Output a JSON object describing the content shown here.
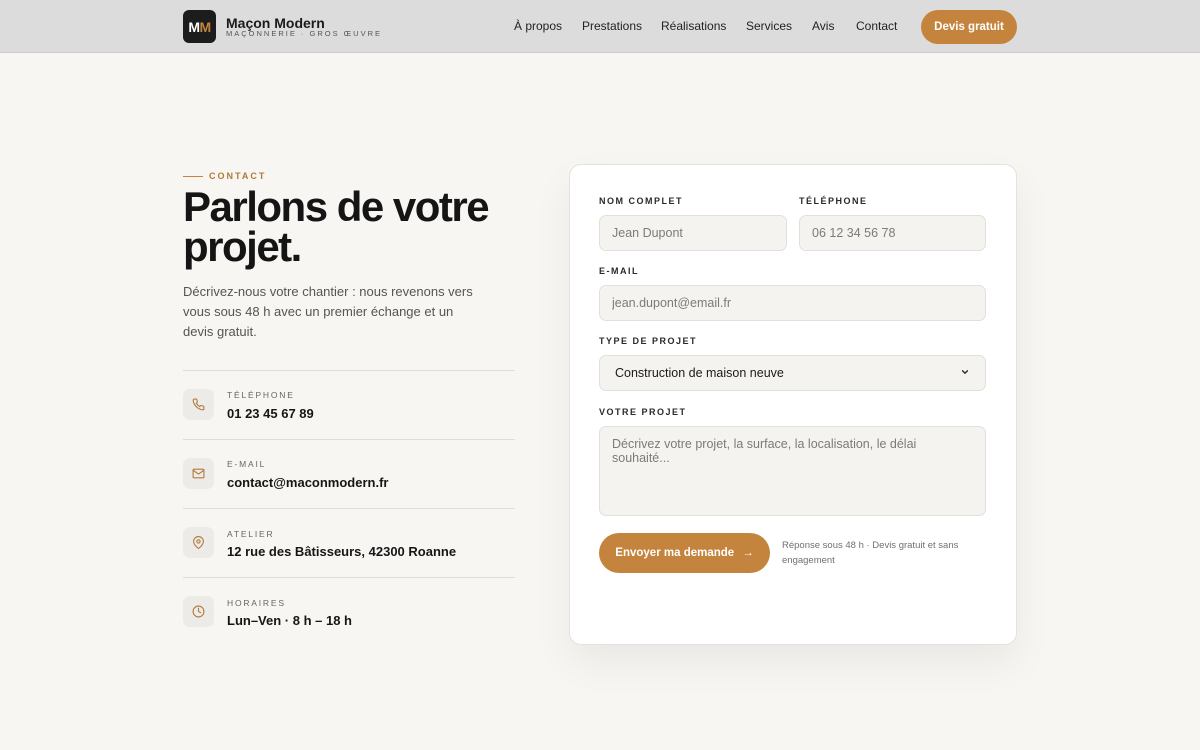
{
  "header": {
    "logo": {
      "letter1": "M",
      "letter2": "M"
    },
    "brand_name": "Maçon Modern",
    "brand_tagline": "MAÇONNERIE · GROS ŒUVRE",
    "nav": [
      "À propos",
      "Prestations",
      "Réalisations",
      "Services",
      "Avis",
      "Contact"
    ],
    "cta_label": "Devis gratuit"
  },
  "contact": {
    "eyebrow": "CONTACT",
    "headline": "Parlons de votre projet.",
    "lede": "Décrivez-nous votre chantier : nous revenons vers vous sous 48 h avec un premier échange et un devis gratuit.",
    "items": [
      {
        "icon": "phone-icon",
        "label": "TÉLÉPHONE",
        "value": "01 23 45 67 89"
      },
      {
        "icon": "mail-icon",
        "label": "E-MAIL",
        "value": "contact@maconmodern.fr"
      },
      {
        "icon": "map-pin-icon",
        "label": "ATELIER",
        "value": "12 rue des Bâtisseurs, 42300 Roanne"
      },
      {
        "icon": "clock-icon",
        "label": "HORAIRES",
        "value": "Lun–Ven · 8 h – 18 h"
      }
    ]
  },
  "form": {
    "name_label": "NOM COMPLET",
    "name_placeholder": "Jean Dupont",
    "phone_label": "TÉLÉPHONE",
    "phone_placeholder": "06 12 34 56 78",
    "email_label": "E-MAIL",
    "email_placeholder": "jean.dupont@email.fr",
    "project_type_label": "TYPE DE PROJET",
    "project_type_value": "Construction de maison neuve",
    "project_label": "VOTRE PROJET",
    "project_placeholder": "Décrivez votre projet, la surface, la localisation, le délai souhaité...",
    "submit_label": "Envoyer ma demande",
    "submit_arrow": "→",
    "note": "Réponse sous 48 h · Devis gratuit et sans engagement"
  },
  "colors": {
    "accent": "#c4843e",
    "header_bg": "#dcdcdc",
    "page_bg": "#f7f6f3"
  }
}
